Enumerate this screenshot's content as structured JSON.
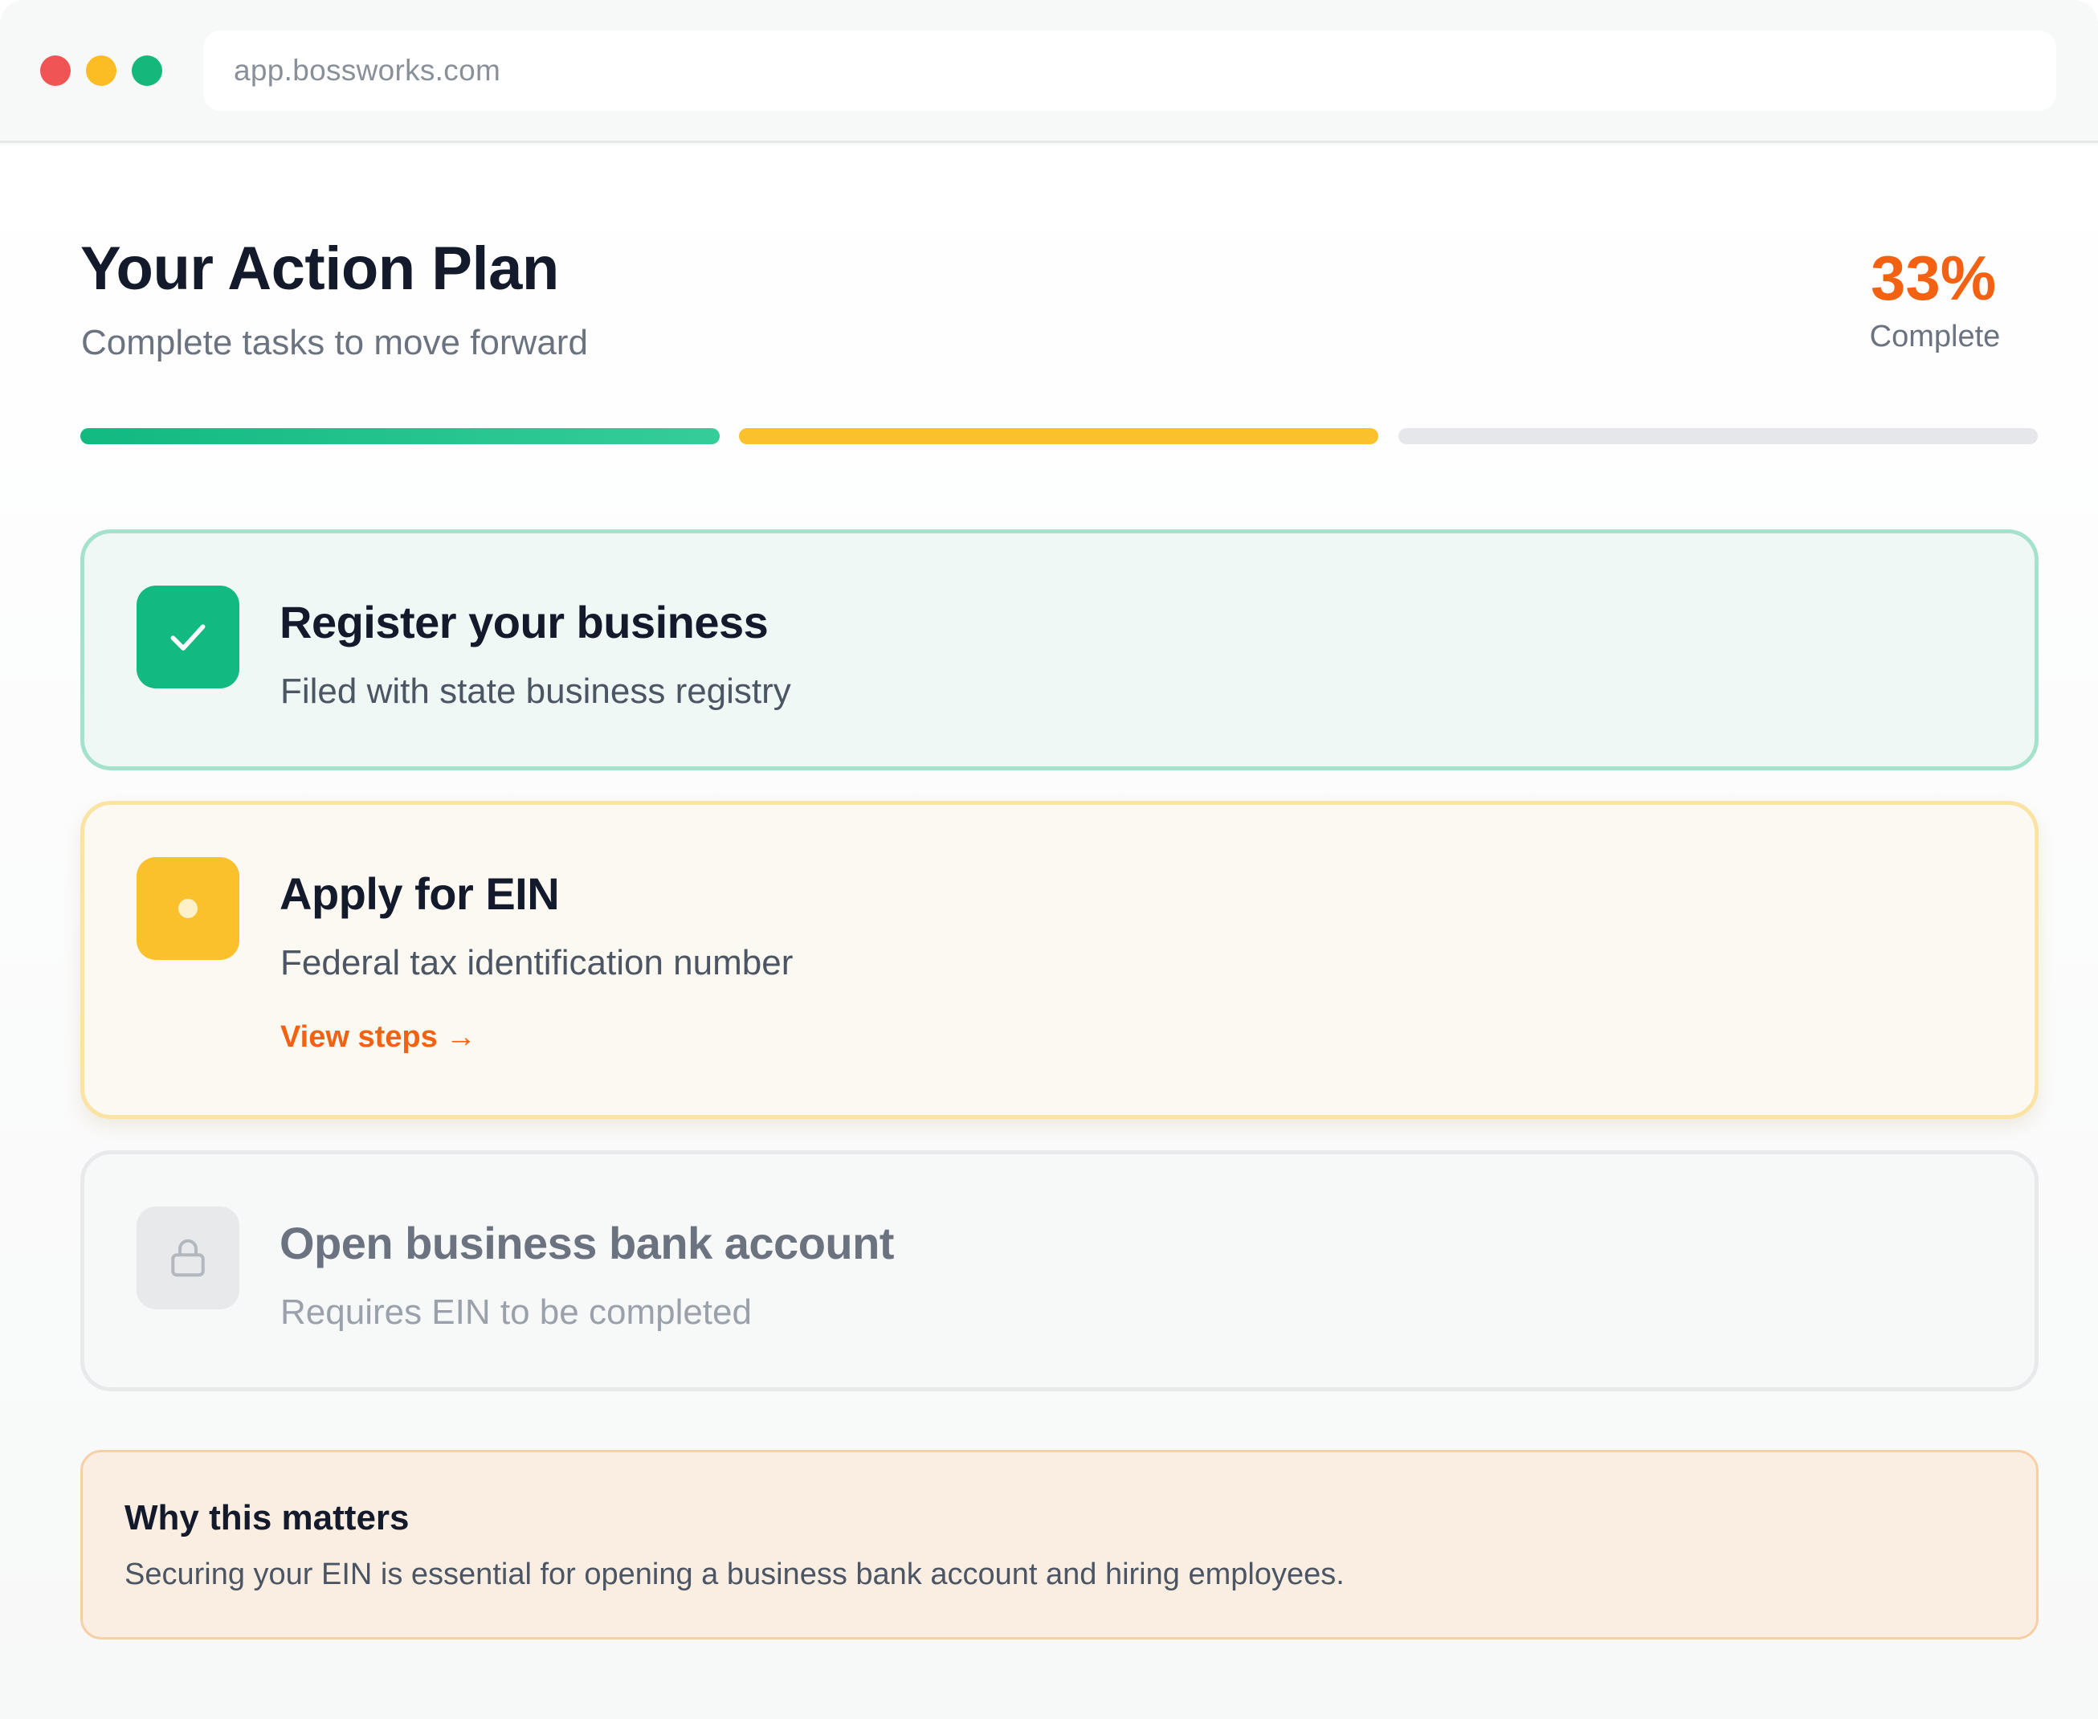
{
  "browser": {
    "url": "app.bossworks.com"
  },
  "header": {
    "title": "Your Action Plan",
    "subtitle": "Complete tasks to move forward",
    "percent": "33%",
    "percent_label": "Complete"
  },
  "progress": {
    "value_fraction": 0.33,
    "segments": [
      {
        "status": "completed",
        "color": "#12b981"
      },
      {
        "status": "in-progress",
        "color": "#fbc12d"
      },
      {
        "status": "pending",
        "color": "#e5e7ea"
      }
    ]
  },
  "tasks": [
    {
      "status": "completed",
      "icon": "check-icon",
      "title": "Register your business",
      "description": "Filed with state business registry"
    },
    {
      "status": "in-progress",
      "icon": "dot-icon",
      "title": "Apply for EIN",
      "description": "Federal tax identification number",
      "link_label": "View steps",
      "link_arrow": "→"
    },
    {
      "status": "locked",
      "icon": "lock-icon",
      "title": "Open business bank account",
      "description": "Requires EIN to be completed"
    }
  ],
  "info": {
    "title": "Why this matters",
    "text": "Securing your EIN is essential for opening a business bank account and hiring employees."
  },
  "colors": {
    "accent": "#f26212",
    "success": "#12b981",
    "warning": "#fbc12d",
    "text_dark": "#121a2b"
  }
}
